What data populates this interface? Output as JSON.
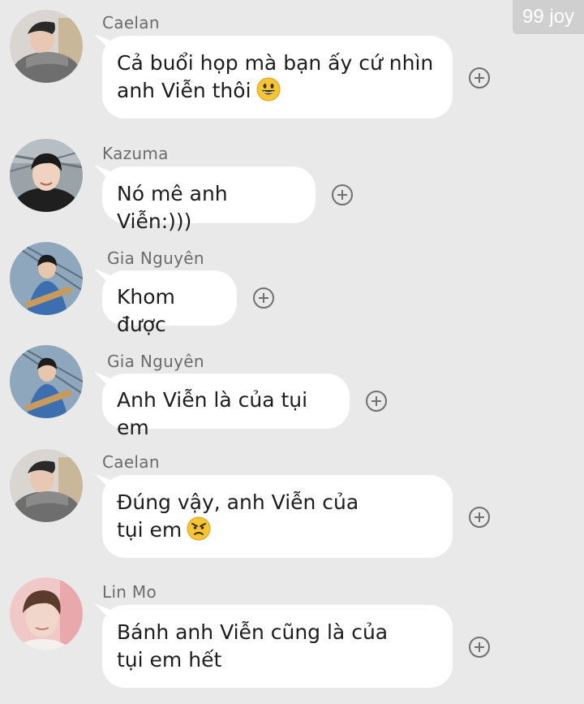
{
  "watermark": "99 joy",
  "messages": [
    {
      "sender": "Caelan",
      "text": "Cả buổi họp mà bạn ấy cứ nhìn\nanh Viễn thôi",
      "emoji": "grinning-face"
    },
    {
      "sender": "Kazuma",
      "text": "Nó mê anh Viễn:)))"
    },
    {
      "sender": "Gia Nguyên",
      "text": "Khom được"
    },
    {
      "sender": "Gia Nguyên",
      "text": "Anh Viễn là của tụi em"
    },
    {
      "sender": "Caelan",
      "text": "Đúng vậy, anh Viễn của\ntụi em",
      "emoji": "angry-face"
    },
    {
      "sender": "Lin Mo",
      "text": "Bánh anh Viễn cũng là của\ntụi em hết"
    }
  ],
  "icons": {
    "react": "add-reaction-icon"
  },
  "colors": {
    "background": "#e9e9e9",
    "bubble": "#ffffff",
    "sender_name": "#6b6b6b",
    "watermark_bg": "#cfcfcf"
  }
}
